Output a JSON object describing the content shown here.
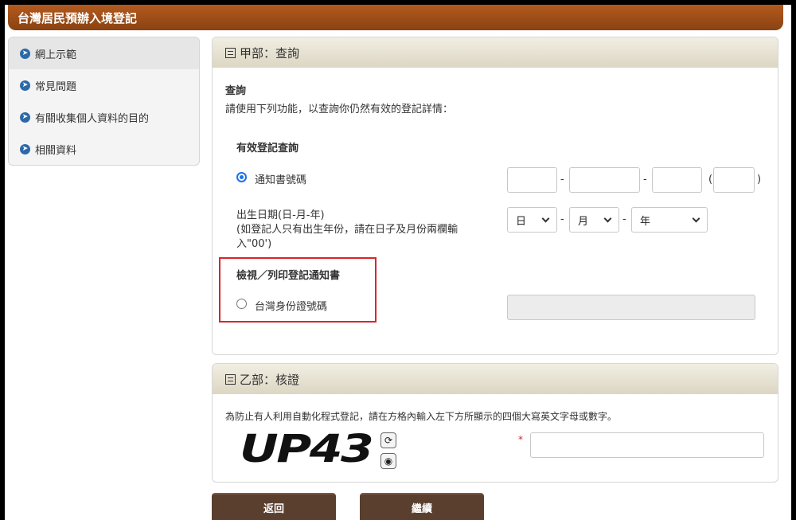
{
  "header": {
    "title": "台灣居民預辦入境登記"
  },
  "sidebar": {
    "items": [
      {
        "label": "網上示範",
        "active": true
      },
      {
        "label": "常見問題"
      },
      {
        "label": "有關收集個人資料的目的"
      },
      {
        "label": "相關資料"
      }
    ]
  },
  "part_a": {
    "title": "甲部：查詢",
    "heading": "查詢",
    "desc": "請使用下列功能，以查詢你仍然有效的登記詳情：",
    "valid_query_title": "有效登記查詢",
    "notice_no_label": "通知書號碼",
    "dob_line1": "出生日期(日-月-年)",
    "dob_line2": "(如登記人只有出生年份，請在日子及月份兩欄輸",
    "dob_line3": "入\"00')",
    "dob_day": "日",
    "dob_month": "月",
    "dob_year": "年",
    "view_print_title": "檢視／列印登記通知書",
    "tw_id_label": "台灣身份證號碼",
    "dash": "-",
    "paren_open": "(",
    "paren_close": ")"
  },
  "part_b": {
    "title": "乙部：核證",
    "desc": "為防止有人利用自動化程式登記，請在方格內輸入左下方所顯示的四個大寫英文字母或數字。",
    "captcha_text": "UP43",
    "required_mark": "*"
  },
  "actions": {
    "back": "返回",
    "continue": "繼續"
  },
  "colors": {
    "accent": "#8a4212",
    "highlight": "#d9252a",
    "button": "#5a3e2e"
  }
}
